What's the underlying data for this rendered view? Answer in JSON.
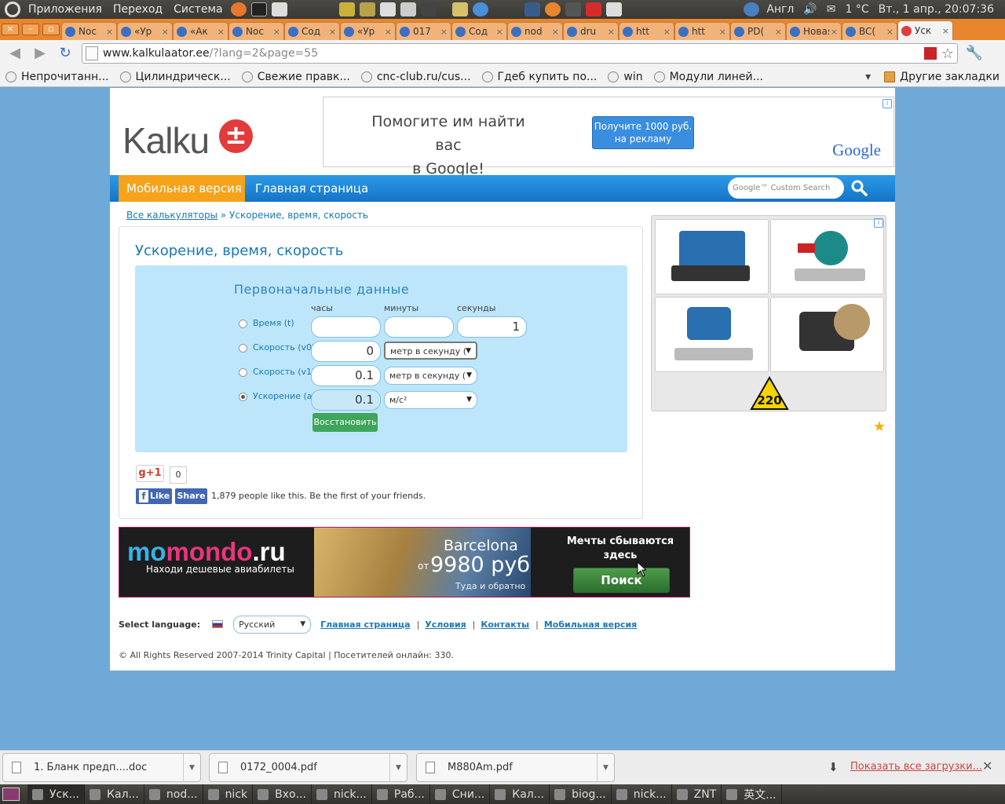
{
  "system_panel": {
    "menus": [
      "Приложения",
      "Переход",
      "Система"
    ],
    "keyboard_layout": "Англ",
    "temperature": "1 °C",
    "clock": "Вт., 1 апр., 20:07:36"
  },
  "tabs": [
    {
      "title": "Noc",
      "active": false
    },
    {
      "title": "«Ур",
      "active": false
    },
    {
      "title": "«Ак",
      "active": false
    },
    {
      "title": "Noc",
      "active": false
    },
    {
      "title": "Сод",
      "active": false
    },
    {
      "title": "«Ур",
      "active": false
    },
    {
      "title": "017",
      "active": false
    },
    {
      "title": "Сод",
      "active": false
    },
    {
      "title": "nod",
      "active": false
    },
    {
      "title": "dru",
      "active": false
    },
    {
      "title": "htt",
      "active": false
    },
    {
      "title": "htt",
      "active": false
    },
    {
      "title": "PD(",
      "active": false
    },
    {
      "title": "Новая",
      "active": false
    },
    {
      "title": "BC(",
      "active": false
    },
    {
      "title": "Уск",
      "active": true
    }
  ],
  "address_bar": {
    "host": "www.kalkulaator.ee",
    "path": "/?lang=2&page=55"
  },
  "bookmarks": {
    "items": [
      "Непрочитанн...",
      "Цилиндрическ...",
      "Свежие правк...",
      "cnc-club.ru/cus...",
      "Гдеб купить по...",
      "win",
      "Модули линей..."
    ],
    "other": "Другие закладки"
  },
  "site": {
    "logo_text": "Kalku",
    "ad_top": {
      "line1": "Помогите им найти вас",
      "line2": "в Google!",
      "button_line1": "Получите 1000 руб.",
      "button_line2": "на рекламу",
      "brand": "Google"
    },
    "nav": {
      "mobile": "Мобильная версия",
      "home": "Главная страница",
      "search_placeholder": "Google™ Custom Search"
    },
    "breadcrumb": {
      "root": "Все калькуляторы",
      "separator": "»",
      "current": "Ускорение, время, скорость"
    },
    "calculator": {
      "title": "Ускорение, время, скорость",
      "heading": "Первоначальные данные",
      "col_hours": "часы",
      "col_minutes": "минуты",
      "col_seconds": "секунды",
      "rows": [
        {
          "label": "Время (t)",
          "selected": false
        },
        {
          "label": "Скорость (v0)",
          "selected": false
        },
        {
          "label": "Скорость (v1)",
          "selected": false
        },
        {
          "label": "Ускорение (a)",
          "selected": true
        }
      ],
      "time_hours": "",
      "time_minutes": "",
      "time_seconds": "1",
      "v0_value": "0",
      "v0_unit": "метр в секунду (",
      "v1_value": "0.1",
      "v1_unit": "метр в секунду (",
      "a_value": "0.1",
      "a_unit": "м/с²",
      "restore": "Восстановить"
    },
    "social": {
      "gplus": "g+1",
      "gplus_count": "0",
      "fb_like": "Like",
      "fb_share": "Share",
      "fb_text": "1,879 people like this. Be the first of your friends."
    },
    "side_ad_logo": "220",
    "momondo": {
      "logo_a": "mo",
      "logo_b": "mondo",
      "logo_c": ".ru",
      "sub": "Находи дешевые авиабилеты",
      "city": "Barcelona",
      "from": "от",
      "price": "9980 руб",
      "roundtrip": "Туда и обратно",
      "dream_text": "Мечты сбываются здесь",
      "search_button": "Поиск"
    },
    "footer": {
      "select_language": "Select language:",
      "language": "Русский",
      "links": [
        "Главная страница",
        "Условия",
        "Контакты",
        "Мобильная версия"
      ],
      "separator": "|",
      "copyright": "© All Rights Reserved 2007-2014 Trinity Capital  |  Посетителей онлайн: 330."
    }
  },
  "downloads": {
    "items": [
      "1. Бланк предп....doc",
      "0172_0004.pdf",
      "M880Am.pdf"
    ],
    "show_all": "Показать все загрузки..."
  },
  "taskbar": {
    "items": [
      "Уск...",
      "Кал...",
      "nod...",
      "nick",
      "Вхо...",
      "nick...",
      "Раб...",
      "Сни...",
      "Кал...",
      "biog...",
      "nick...",
      "ZNT",
      "英文..."
    ]
  },
  "colors": {
    "accent_orange": "#f6a21b",
    "nav_blue": "#1673c6",
    "link_blue": "#1b78b6",
    "panel_blue": "#bde6fb",
    "restore_green": "#3ea55a",
    "page_background": "#6ea9d8"
  }
}
